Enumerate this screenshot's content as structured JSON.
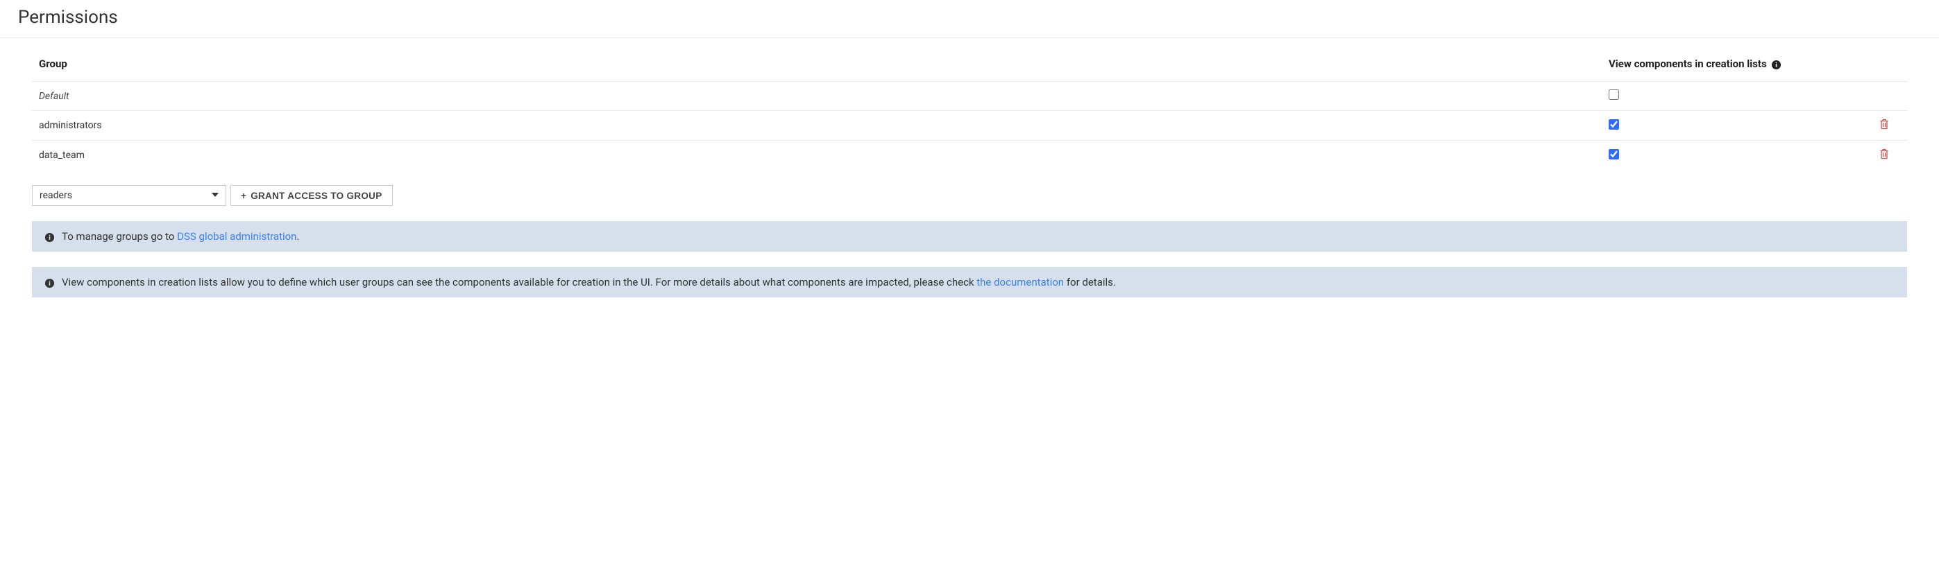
{
  "page": {
    "title": "Permissions"
  },
  "table": {
    "headers": {
      "group": "Group",
      "view": "View components in creation lists"
    },
    "rows": [
      {
        "name": "Default",
        "italic": true,
        "checked": false,
        "deletable": false
      },
      {
        "name": "administrators",
        "italic": false,
        "checked": true,
        "deletable": true
      },
      {
        "name": "data_team",
        "italic": false,
        "checked": true,
        "deletable": true
      }
    ]
  },
  "controls": {
    "selected_group": "readers",
    "grant_plus": "+",
    "grant_label": "GRANT ACCESS TO GROUP"
  },
  "banners": {
    "manage_prefix": "To manage groups go to ",
    "manage_link": "DSS global administration",
    "manage_suffix": ".",
    "view_prefix": "View components in creation lists allow you to define which user groups can see the components available for creation in the UI. For more details about what components are impacted, please check ",
    "view_link": "the documentation",
    "view_suffix": " for details."
  }
}
